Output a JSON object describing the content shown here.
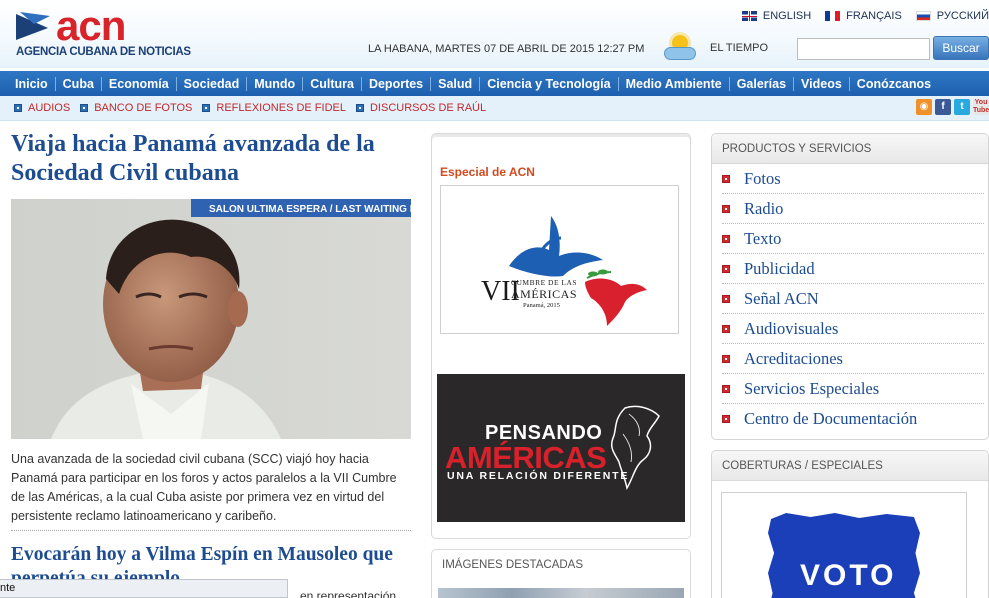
{
  "header": {
    "logo_text": "acn",
    "logo_tagline": "AGENCIA CUBANA DE NOTICIAS",
    "languages": [
      {
        "label": "ENGLISH",
        "flag": "uk-flag-icon"
      },
      {
        "label": "FRANÇAIS",
        "flag": "france-flag-icon"
      },
      {
        "label": "РУССКИЙ",
        "flag": "russia-flag-icon"
      }
    ],
    "dateline": "LA HABANA, MARTES 07 DE ABRIL DE 2015 12:27 PM",
    "weather_label": "EL TIEMPO",
    "search_value": "",
    "search_button": "Buscar"
  },
  "nav": {
    "items": [
      "Inicio",
      "Cuba",
      "Economía",
      "Sociedad",
      "Mundo",
      "Cultura",
      "Deportes",
      "Salud",
      "Ciencia y Tecnología",
      "Medio Ambiente",
      "Galerías",
      "Videos",
      "Conózcanos"
    ]
  },
  "subnav": {
    "links": [
      "AUDIOS",
      "BANCO DE FOTOS",
      "REFLEXIONES DE FIDEL",
      "DISCURSOS DE RAÚL"
    ],
    "social": [
      "rss-icon",
      "facebook-icon",
      "twitter-icon",
      "youtube-icon"
    ]
  },
  "main_story": {
    "title": "Viaja hacia Panamá avanzada de la Sociedad Civil cubana",
    "photo_sign": "SALON ULTIMA ESPERA / LAST WAITING ROOM",
    "summary": "Una avanzada de la sociedad civil cubana (SCC) viajó hoy hacia Panamá para participar en los foros y actos paralelos a la VII Cumbre de las Américas, a la cual Cuba asiste por primera vez en virtud del persistente reclamo latinoamericano y caribeño."
  },
  "second_story": {
    "title": "Evocarán hoy a Vilma Espín en Mausoleo que perpetúa su ejemplo",
    "snippet": "...en representación"
  },
  "statusbar": {
    "text": "nte"
  },
  "middle": {
    "special_label": "Especial de ACN",
    "cumbre": {
      "numeral": "VII",
      "line1": "CUMBRE DE LAS",
      "line2": "AMÉRICAS",
      "line3": "Panamá, 2015"
    },
    "pensando": {
      "line1": "PENSANDO",
      "line2": "AMÉRICAS",
      "line3": "UNA RELACIÓN DIFERENTE"
    },
    "images_title": "IMÁGENES DESTACADAS"
  },
  "right": {
    "products_title": "PRODUCTOS Y SERVICIOS",
    "products": [
      "Fotos",
      "Radio",
      "Texto",
      "Publicidad",
      "Señal ACN",
      "Audiovisuales",
      "Acreditaciones",
      "Servicios Especiales",
      "Centro de Documentación"
    ],
    "coverage_title": "COBERTURAS / ESPECIALES",
    "voto_text": "VOTO"
  },
  "colors": {
    "brand_red": "#d8232a",
    "nav_blue": "#1d5fae",
    "link_blue": "#1d4c91",
    "subnav_red": "#c0282b"
  }
}
